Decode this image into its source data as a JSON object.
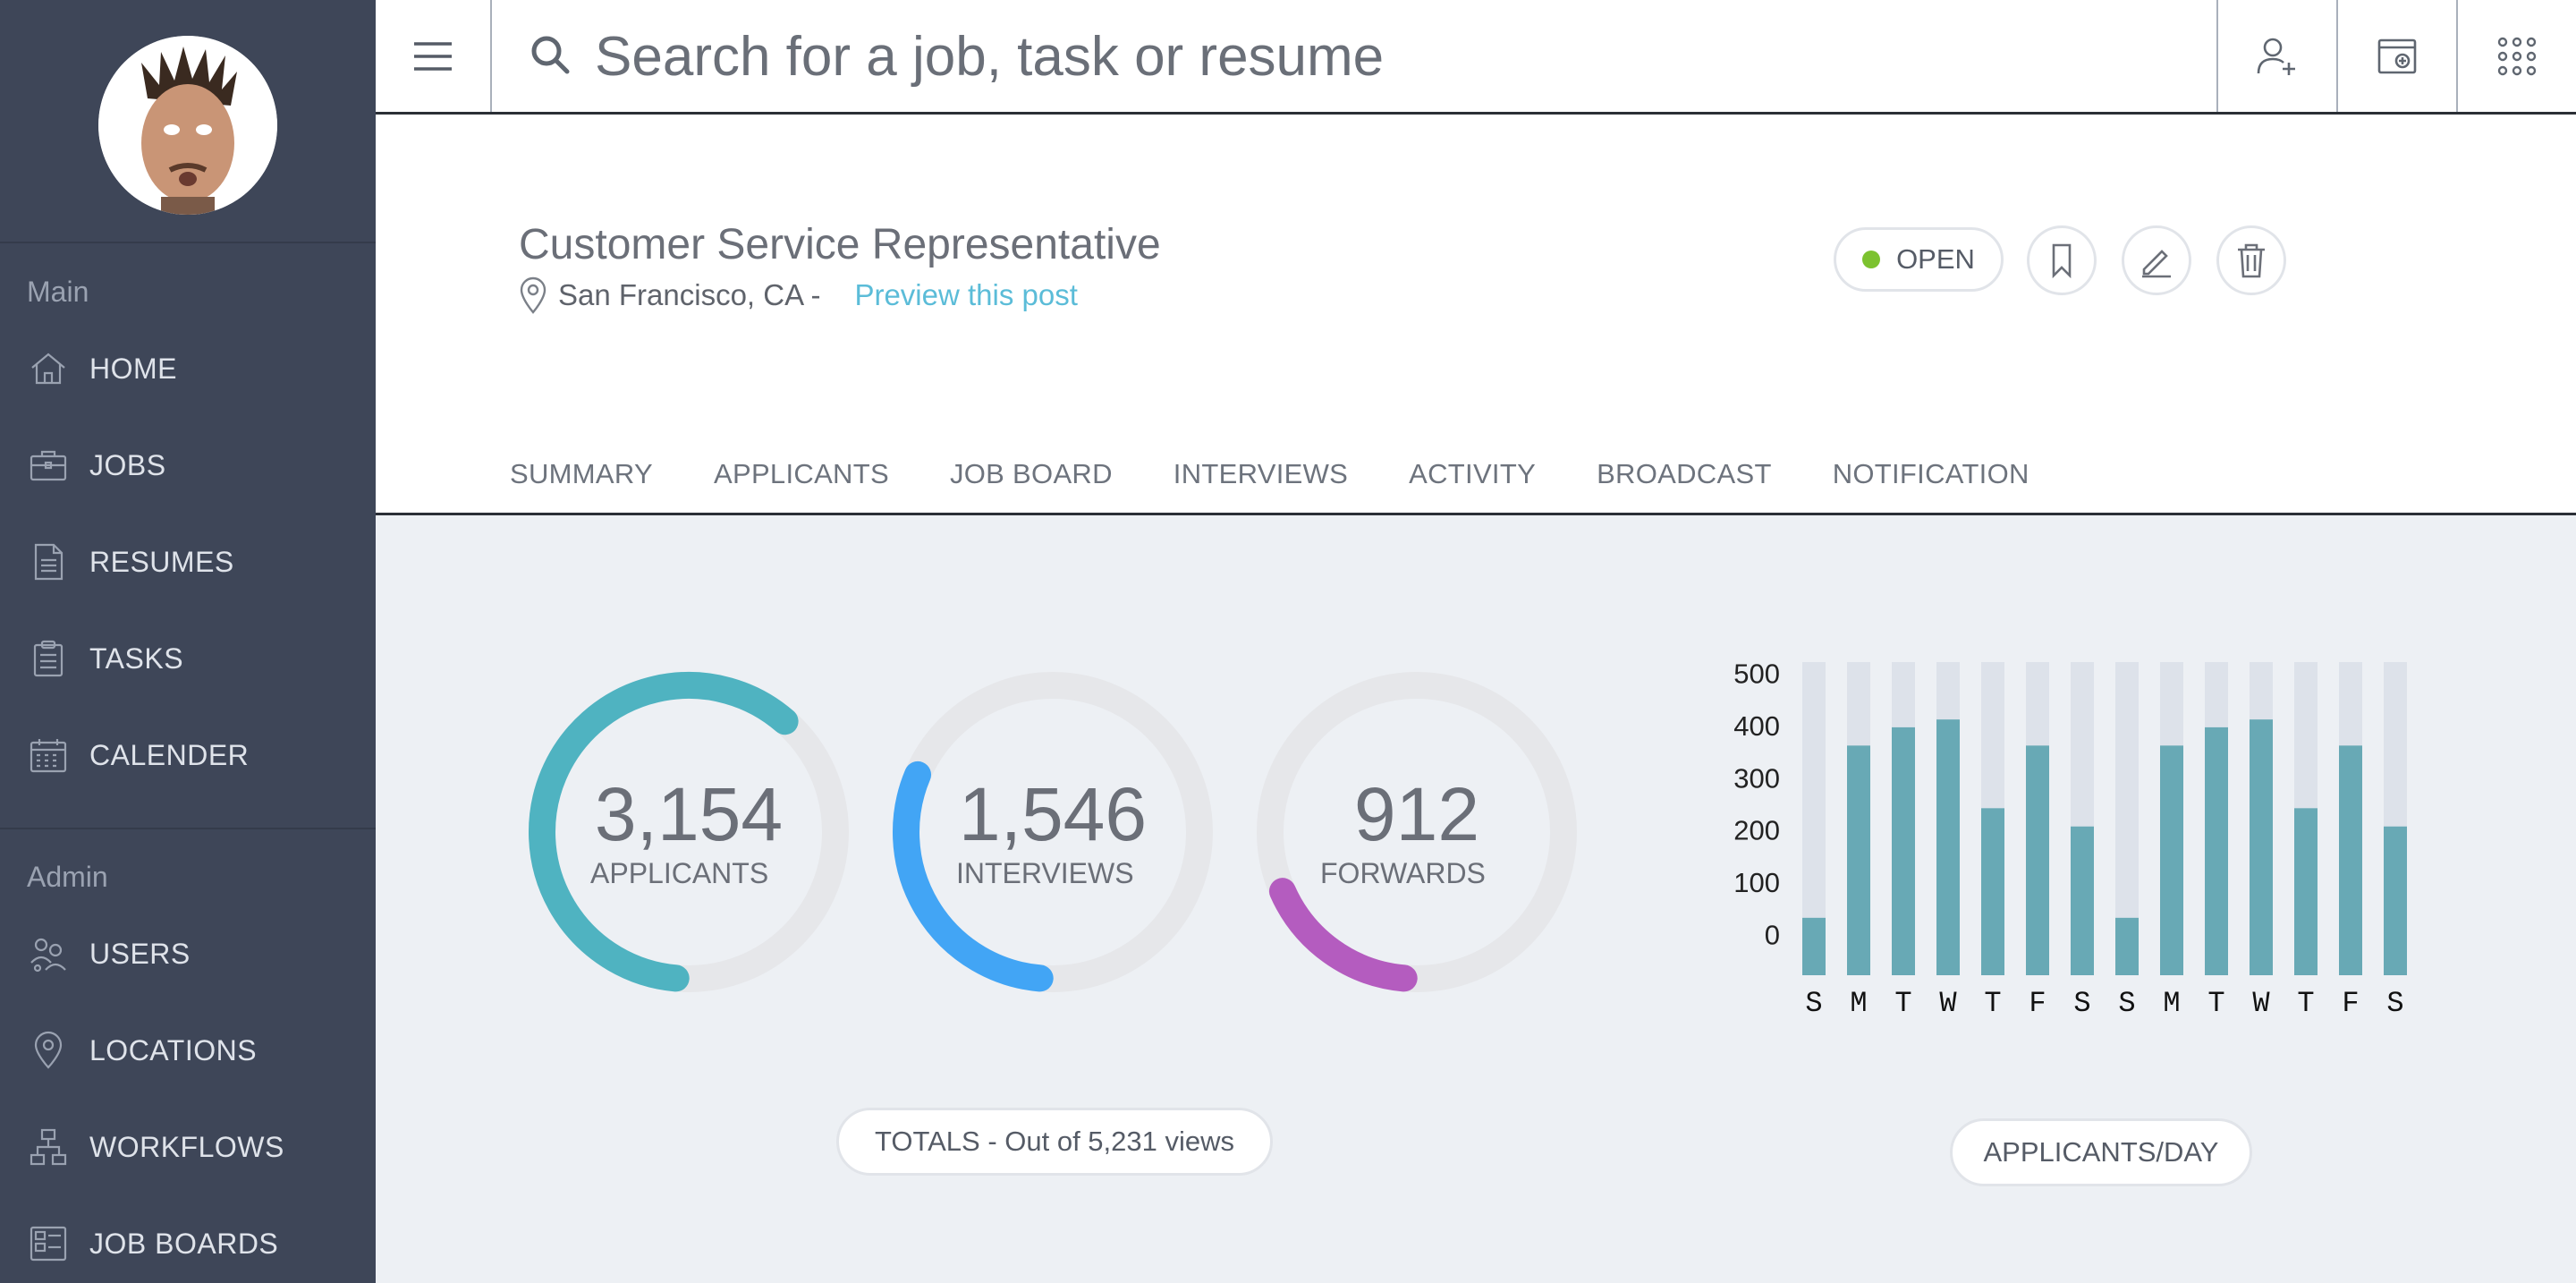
{
  "sidebar": {
    "main_label": "Main",
    "admin_label": "Admin",
    "main_items": [
      {
        "label": "HOME",
        "icon": "home-icon"
      },
      {
        "label": "JOBS",
        "icon": "briefcase-icon"
      },
      {
        "label": "RESUMES",
        "icon": "document-icon"
      },
      {
        "label": "TASKS",
        "icon": "clipboard-icon"
      },
      {
        "label": "CALENDER",
        "icon": "calendar-icon"
      }
    ],
    "admin_items": [
      {
        "label": "USERS",
        "icon": "users-icon"
      },
      {
        "label": "LOCATIONS",
        "icon": "location-pin-icon"
      },
      {
        "label": "WORKFLOWS",
        "icon": "workflow-icon"
      },
      {
        "label": "JOB BOARDS",
        "icon": "job-board-icon"
      }
    ]
  },
  "topbar": {
    "search_placeholder": "Search for a job, task or resume"
  },
  "job": {
    "title": "Customer Service Representative",
    "location": "San Francisco, CA -",
    "preview_link": "Preview this post",
    "status": "OPEN",
    "status_color": "#7cc22f"
  },
  "tabs": [
    "SUMMARY",
    "APPLICANTS",
    "JOB BOARD",
    "INTERVIEWS",
    "ACTIVITY",
    "BROADCAST",
    "NOTIFICATION"
  ],
  "stats": [
    {
      "value": "3,154",
      "label": "APPLICANTS",
      "fraction": 0.6,
      "color": "#4fb3c1"
    },
    {
      "value": "1,546",
      "label": "INTERVIEWS",
      "fraction": 0.3,
      "color": "#42a5f5"
    },
    {
      "value": "912",
      "label": "FORWARDS",
      "fraction": 0.17,
      "color": "#b45cbf"
    }
  ],
  "totals_label": "TOTALS - Out of 5,231 views",
  "chart_label": "APPLICANTS/DAY",
  "chart_data": {
    "type": "bar",
    "categories": [
      "S",
      "M",
      "T",
      "W",
      "T",
      "F",
      "S",
      "S",
      "M",
      "T",
      "W",
      "T",
      "F",
      "S"
    ],
    "values": [
      30,
      360,
      395,
      410,
      240,
      360,
      205,
      30,
      360,
      395,
      410,
      240,
      360,
      205
    ],
    "y_ticks": [
      "500",
      "400",
      "300",
      "200",
      "100",
      "0"
    ],
    "ylim": [
      -80,
      520
    ],
    "bar_color": "#68a9b5",
    "track_color": "#dde2ea"
  }
}
